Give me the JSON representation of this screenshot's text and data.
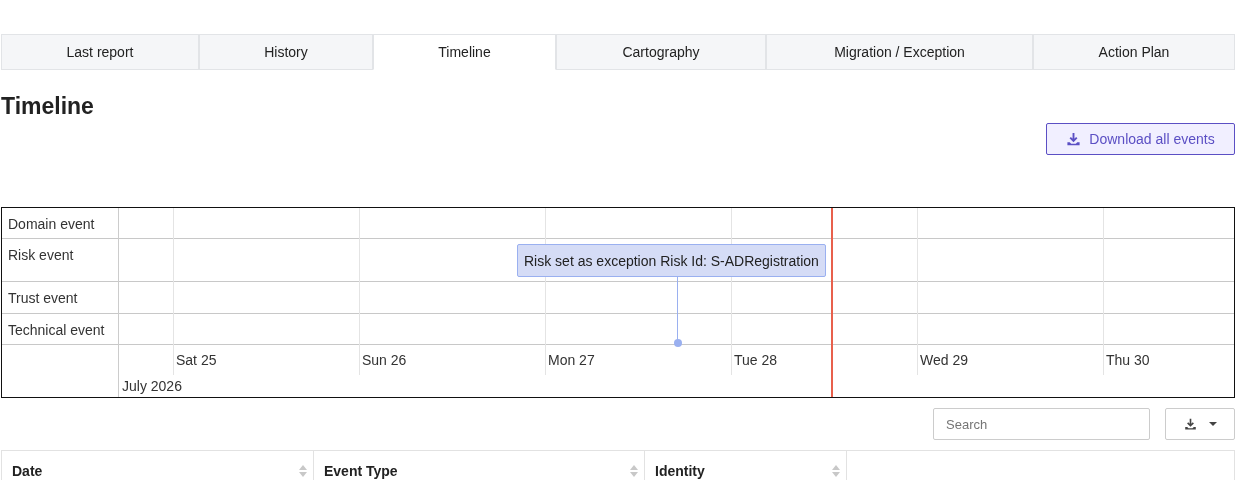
{
  "tabs": [
    {
      "label": "Last report",
      "selected": false
    },
    {
      "label": "History",
      "selected": false
    },
    {
      "label": "Timeline",
      "selected": true
    },
    {
      "label": "Cartography",
      "selected": false
    },
    {
      "label": "Migration / Exception",
      "selected": false
    },
    {
      "label": "Action Plan",
      "selected": false
    }
  ],
  "page_title": "Timeline",
  "download_button": "Download all events",
  "timeline": {
    "lanes": [
      {
        "label": "Domain event"
      },
      {
        "label": "Risk event",
        "events": [
          {
            "text": "Risk set as exception Risk Id: S-ADRegistration"
          }
        ]
      },
      {
        "label": "Trust event"
      },
      {
        "label": "Technical event"
      }
    ],
    "days": [
      "Sat 25",
      "Sun 26",
      "Mon 27",
      "Tue 28",
      "Wed 29",
      "Thu 30"
    ],
    "month": "July 2026"
  },
  "search": {
    "placeholder": "Search"
  },
  "table": {
    "columns": [
      {
        "label": "Date",
        "sortable": true
      },
      {
        "label": "Event Type",
        "sortable": true
      },
      {
        "label": "Identity",
        "sortable": true
      }
    ]
  }
}
